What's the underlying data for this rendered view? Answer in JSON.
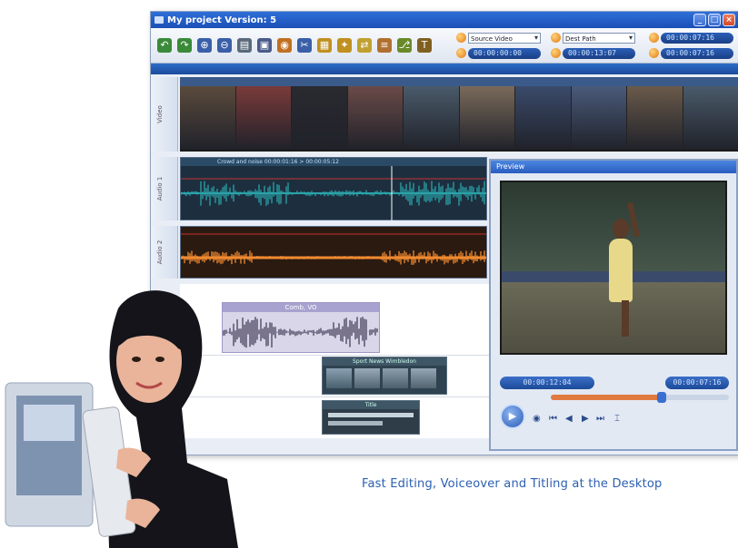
{
  "window": {
    "title": "My project Version: 5"
  },
  "toolbar": {
    "icons": [
      "undo-icon",
      "redo-icon",
      "zoom-in-icon",
      "zoom-out-icon",
      "library-icon",
      "save-icon",
      "record-icon",
      "tool-icon",
      "clip-icon",
      "effects-icon",
      "transition-icon",
      "stack-icon",
      "split-icon",
      "text-icon"
    ],
    "dropdown_1": "Source Video",
    "dropdown_2": "Dest Path",
    "timecodes": [
      "00:00:00:00",
      "00:00:13:07",
      "00:00:07:16",
      "00:00:07:16"
    ]
  },
  "tracks": [
    {
      "label": "Video"
    },
    {
      "label": "Audio 1",
      "clip_label": "Crowd and noise  00:00:01:16 > 00:00:05:12"
    },
    {
      "label": "Audio 2"
    }
  ],
  "clips": {
    "voiceover": "Comb, VO",
    "title": "Title",
    "title_text": "Sport News  Wimbledon"
  },
  "preview": {
    "title": "Preview",
    "timecode_left": "00:00:12:04",
    "timecode_right": "00:00:07:16",
    "progress": 0.62
  },
  "caption": "Fast Editing, Voiceover and Titling at the Desktop",
  "colors": {
    "accent": "#2b5fb0",
    "titlebar": "#2f6fd8",
    "audio_teal": "#2aa3a8",
    "audio_orange": "#f08a30"
  }
}
